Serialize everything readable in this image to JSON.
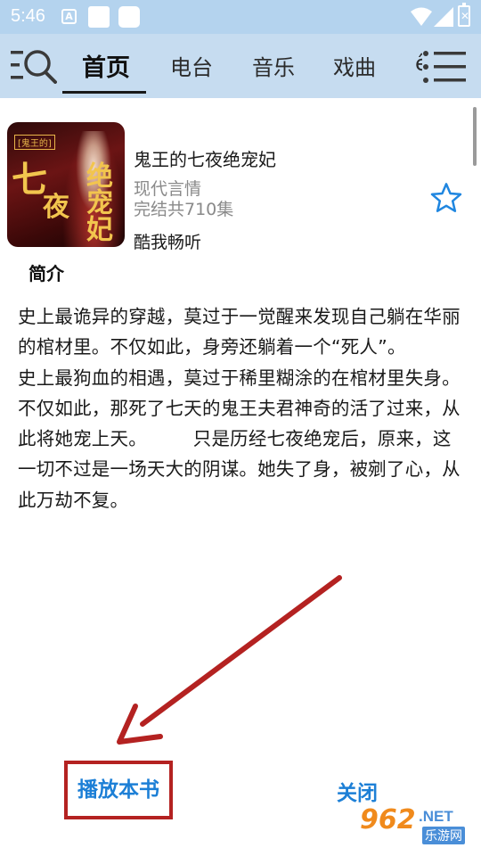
{
  "status_bar": {
    "time": "5:46",
    "a_icon": "A"
  },
  "nav": {
    "tabs": [
      {
        "label": "首页",
        "active": true
      },
      {
        "label": "电台",
        "active": false
      },
      {
        "label": "音乐",
        "active": false
      },
      {
        "label": "戏曲",
        "active": false
      }
    ],
    "accent_color": "#c6dcf0"
  },
  "book": {
    "cover_tag": "[鬼王的]",
    "cover_title_parts": [
      "七",
      "夜",
      "绝宠妃"
    ],
    "title": "鬼王的七夜绝宠妃",
    "genre": "现代言情",
    "episodes": "完结共710集",
    "source": "酷我畅听"
  },
  "intro": {
    "heading": "简介",
    "text": "史上最诡异的穿越，莫过于一觉醒来发现自己躺在华丽的棺材里。不仅如此，身旁还躺着一个“死人”。　　　史上最狗血的相遇，莫过于稀里糊涂的在棺材里失身。不仅如此，那死了七天的鬼王夫君神奇的活了过来，从此将她宠上天。　　　只是历经七夜绝宠后，原来，这一切不过是一场天大的阴谋。她失了身，被剜了心，从此万劫不复。"
  },
  "actions": {
    "play_label": "播放本书",
    "close_label": "关闭",
    "link_color": "#1c7fd6",
    "highlight_color": "#b42221"
  },
  "watermark": {
    "number": "962",
    "net": ".NET",
    "cn": "乐游网"
  }
}
